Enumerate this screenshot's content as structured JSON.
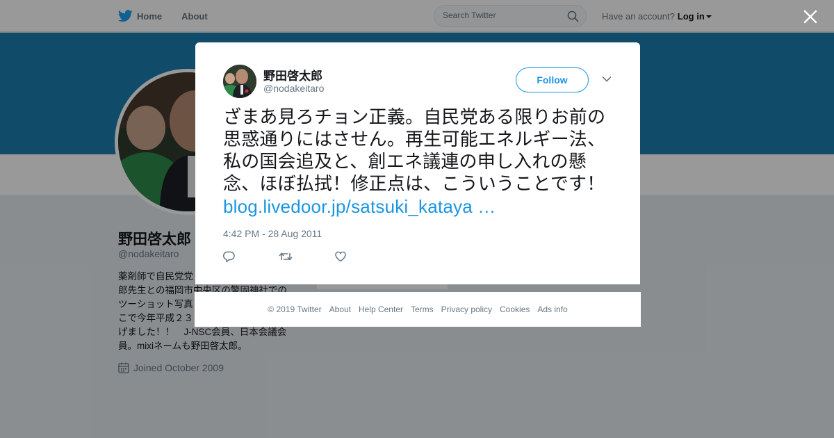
{
  "nav": {
    "home_label": "Home",
    "about_label": "About",
    "search_placeholder": "Search Twitter",
    "have_account": "Have an account?",
    "login_label": "Log in"
  },
  "profile": {
    "name": "野田啓太郎",
    "handle": "@nodakeitaro",
    "bio_lines": [
      "薬剤師で自民党党",
      "郎先生との福岡市中央区の警固神社での",
      "ツーショット写真",
      "こで今年平成２３",
      "げました！！　J-NSC会員、日本会議会",
      "員。mixiネームも野田啓太郎。"
    ],
    "joined": "Joined October 2009"
  },
  "tweet": {
    "author_name": "野田啓太郎",
    "author_handle": "@nodakeitaro",
    "follow_label": "Follow",
    "text": "ざまあ見ろチョン正義。自民党ある限りお前の思惑通りにはさせん。再生可能エネルギー法、私の国会追及と、創エネ議連の申し入れの懸念、ほぼ払拭！修正点は、こういうことです！ ",
    "link_text": "blog.livedoor.jp/satsuki_kataya …",
    "timestamp": "4:42 PM - 28 Aug 2011"
  },
  "footer": {
    "items": [
      "© 2019 Twitter",
      "About",
      "Help Center",
      "Terms",
      "Privacy policy",
      "Cookies",
      "Ads info"
    ]
  },
  "colors": {
    "accent": "#1b95e0",
    "banner": "#1b7eb0",
    "background": "#e6ecf0"
  }
}
